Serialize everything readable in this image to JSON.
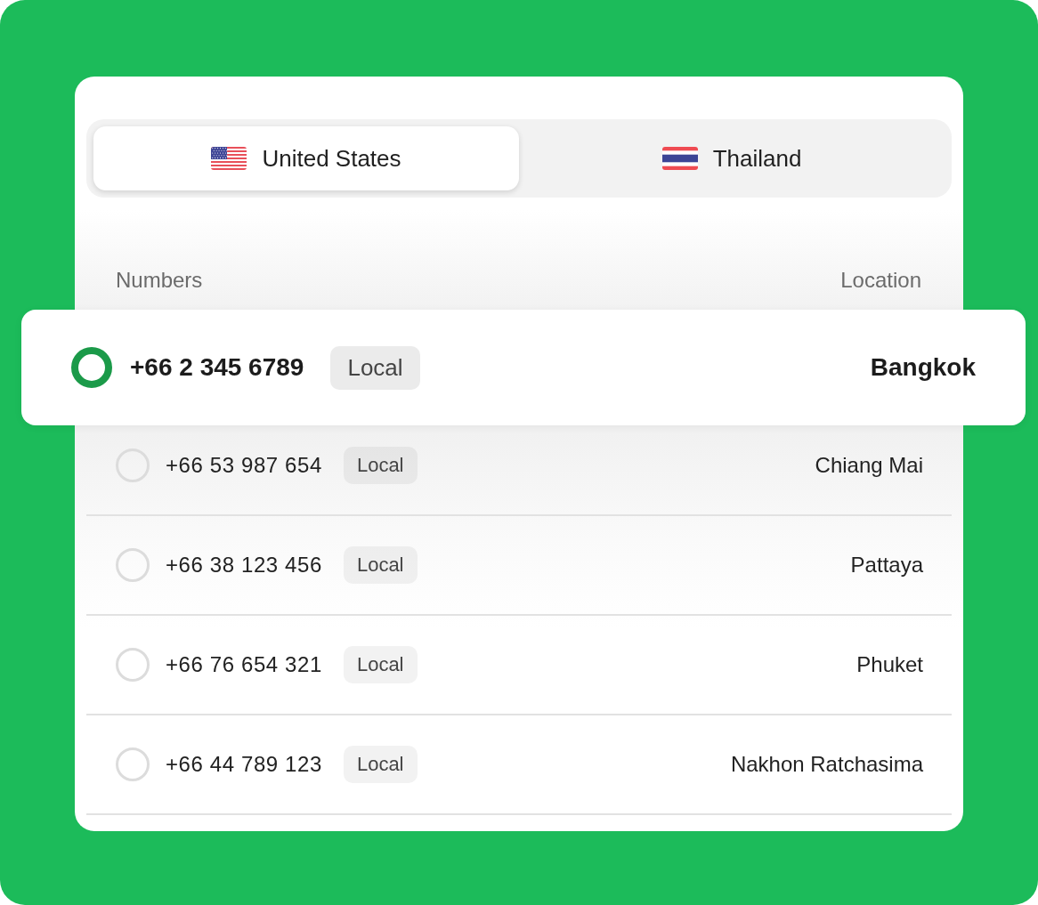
{
  "tabs": [
    {
      "label": "United States",
      "kind": "us",
      "selected": true
    },
    {
      "label": "Thailand",
      "kind": "th",
      "selected": false
    }
  ],
  "table": {
    "columns": [
      "Numbers",
      "Location"
    ],
    "rows": [
      {
        "number": "+66 2 345 6789",
        "type": "Local",
        "location": "Bangkok",
        "selected": true
      },
      {
        "number": "+66 53 987 654",
        "type": "Local",
        "location": "Chiang Mai",
        "selected": false
      },
      {
        "number": "+66 38 123 456",
        "type": "Local",
        "location": "Pattaya",
        "selected": false
      },
      {
        "number": "+66 76 654 321",
        "type": "Local",
        "location": "Phuket",
        "selected": false
      },
      {
        "number": "+66 44 789 123",
        "type": "Local",
        "location": "Nakhon Ratchasima",
        "selected": false
      }
    ]
  }
}
